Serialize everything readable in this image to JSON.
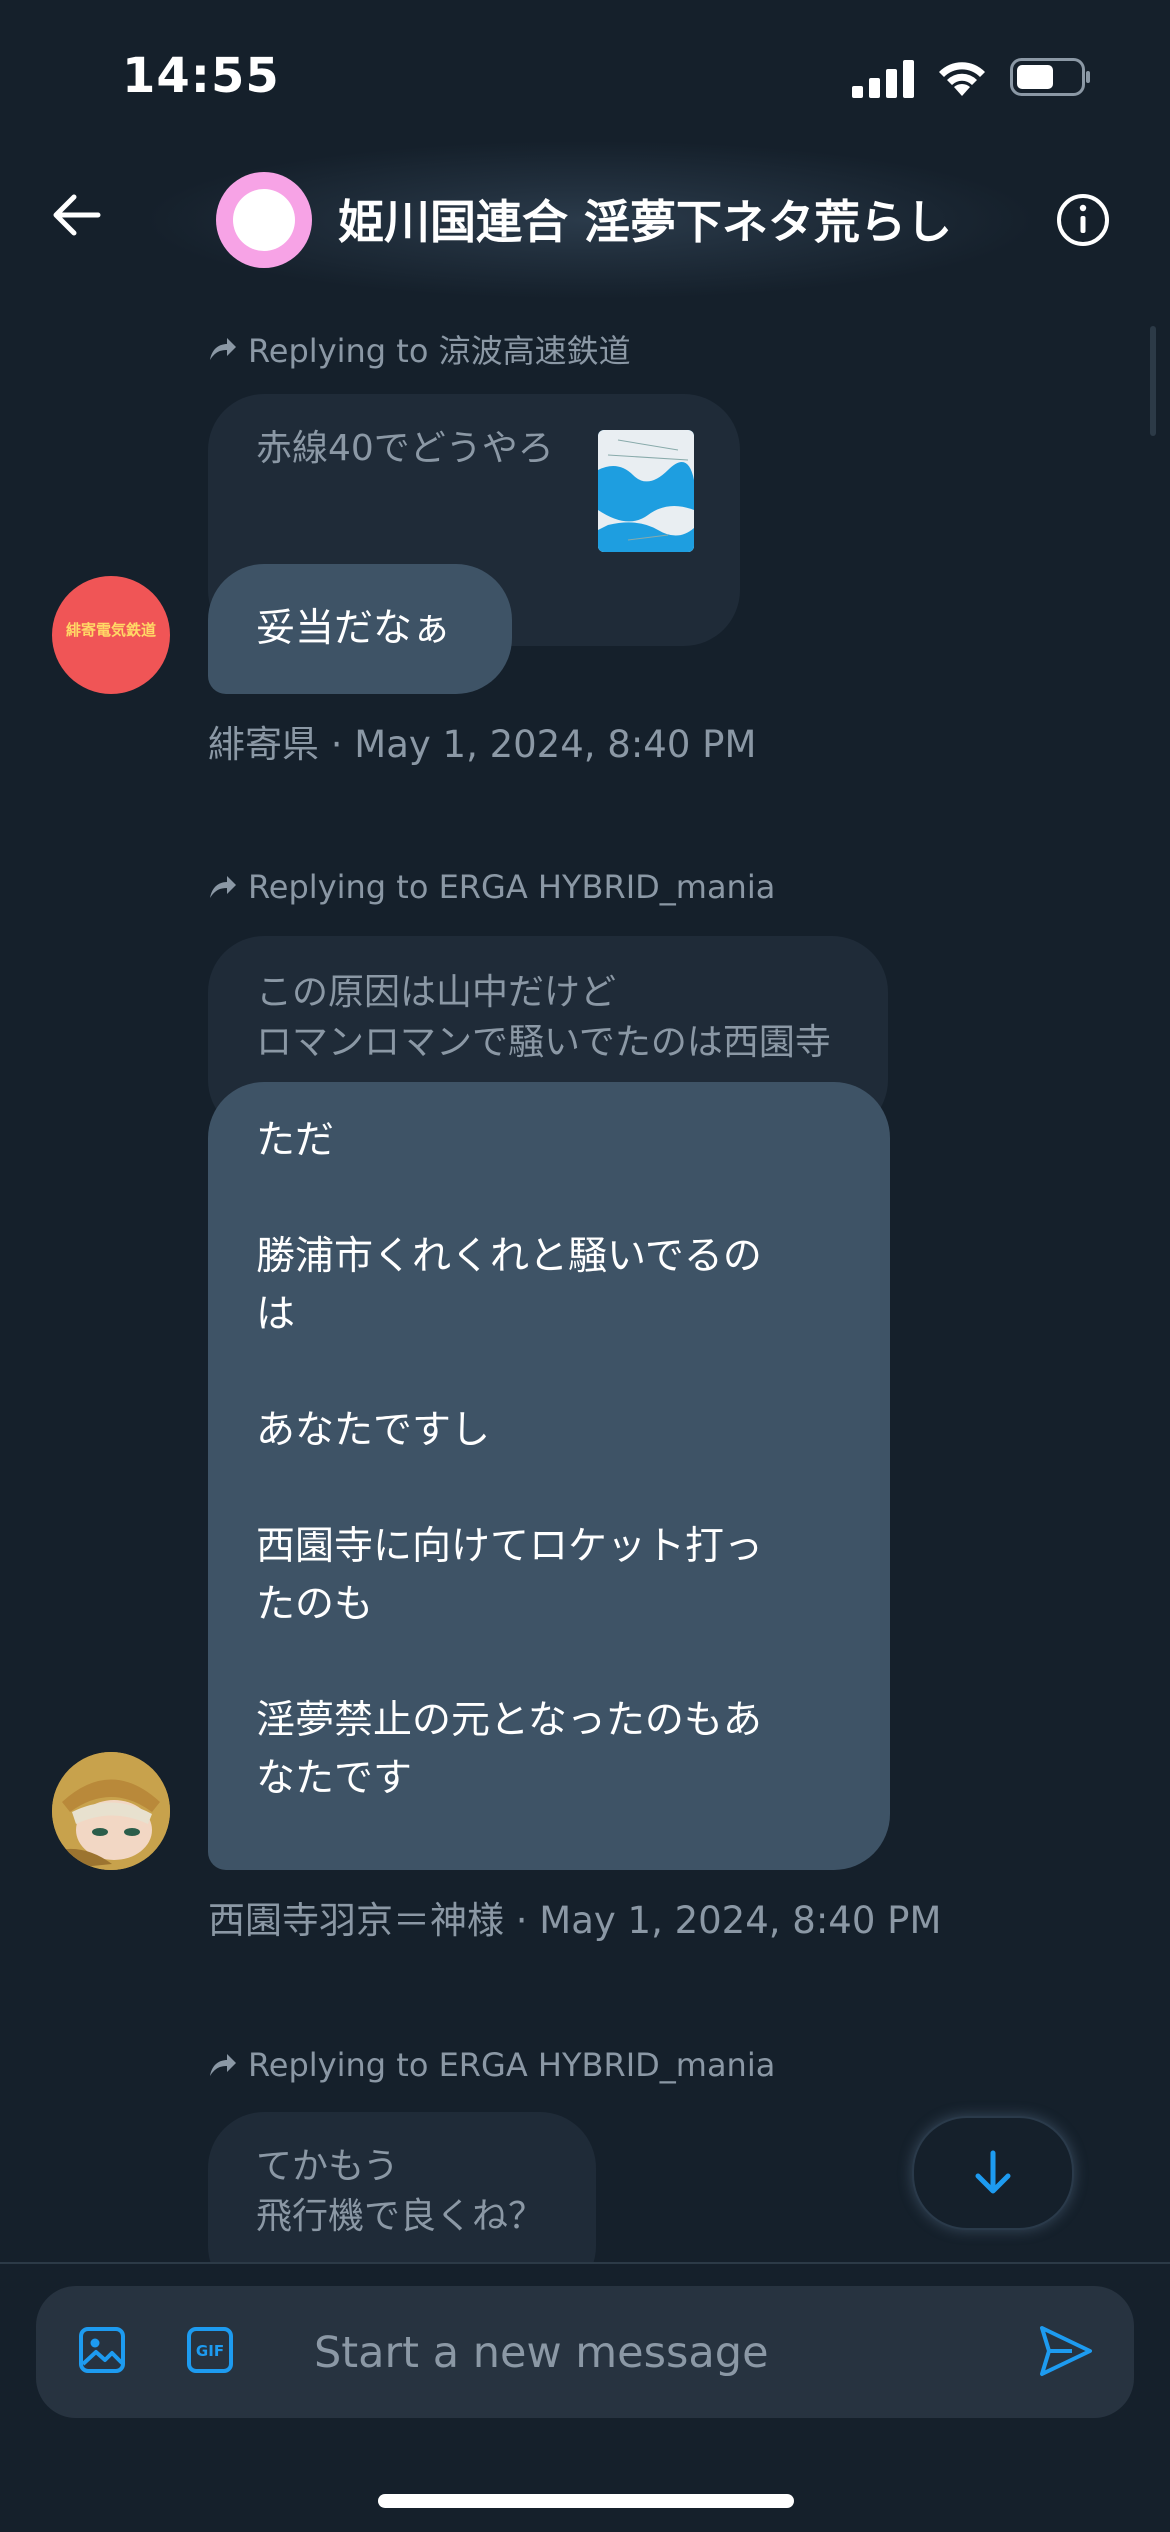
{
  "status_bar": {
    "time": "14:55"
  },
  "header": {
    "title": "姫川国連合 淫夢下ネタ荒らし"
  },
  "messages": [
    {
      "reply_label": "Replying to 涼波高速鉄道",
      "quoted_text": "赤線40でどうやろ",
      "bubbles": [
        "妥当だなぁ"
      ],
      "meta": "緋寄県 · May 1, 2024, 8:40 PM",
      "avatar_text": "緋寄電気鉄道"
    },
    {
      "reply_label": "Replying to ERGA HYBRID_mania",
      "quoted_text": "この原因は山中だけど\nロマンロマンで騒いでたのは西園寺",
      "bubbles": [
        "ただ\n\n勝浦市くれくれと騒いでるの\nは\n\nあなたですし\n\n西園寺に向けてロケット打っ\nたのも\n\n淫夢禁止の元となったのもあ\nなたです"
      ],
      "meta": "西園寺羽京＝神様 · May 1, 2024, 8:40 PM"
    },
    {
      "reply_label": "Replying to ERGA HYBRID_mania",
      "quoted_text": "てかもう\n飛行機で良くね？"
    }
  ],
  "composer": {
    "placeholder": "Start a new message"
  },
  "colors": {
    "accent": "#1d9bf0",
    "background": "#15202b",
    "bubble": "#3e5366"
  }
}
